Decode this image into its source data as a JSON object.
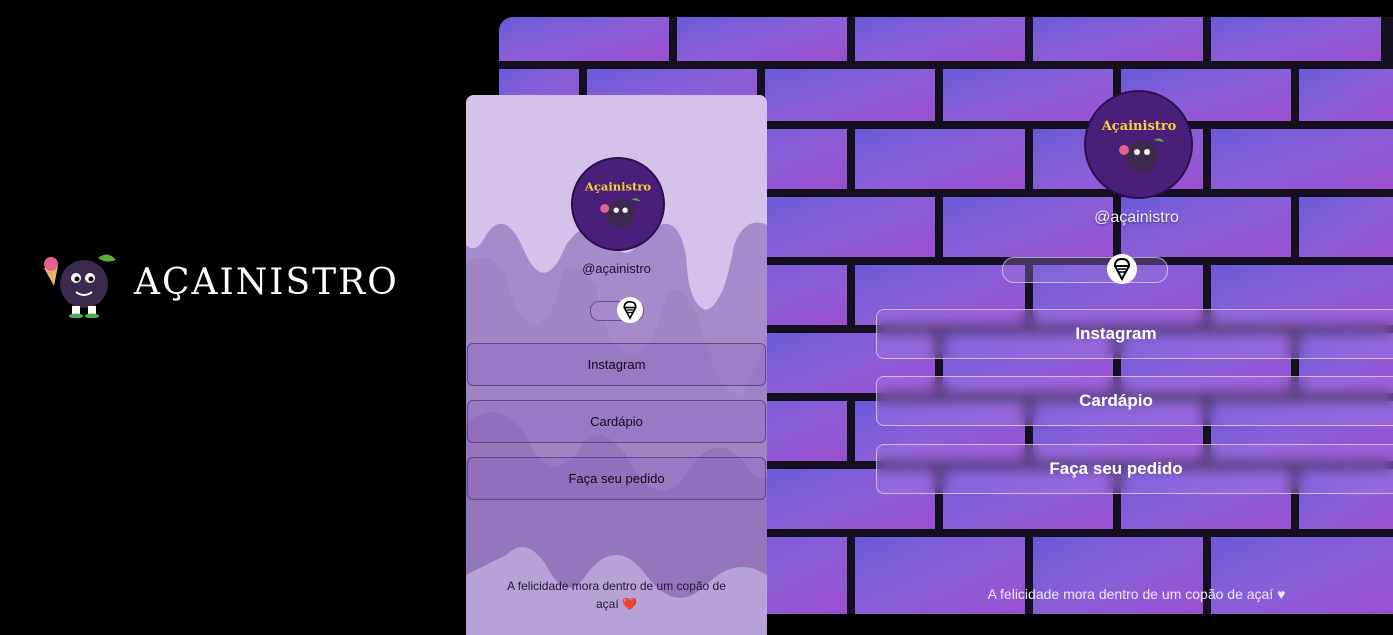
{
  "brand": {
    "name": "AÇAINISTRO",
    "mascot_icon": "acai-mascot-icon"
  },
  "profile": {
    "handle": "@açainistro",
    "avatar_text": "Açainistro",
    "toggle_icon": "ice-cream-icon"
  },
  "links": [
    {
      "label": "Instagram"
    },
    {
      "label": "Cardápio"
    },
    {
      "label": "Faça seu pedido"
    }
  ],
  "footer": {
    "mobile_text": "A felicidade mora dentro de um copão de açaí",
    "mobile_heart": "❤️",
    "desktop_text": "A felicidade mora dentro de um copão de açaí ♥"
  },
  "colors": {
    "background": "#000000",
    "brick": "#7c5ad6",
    "mortar": "#14101f",
    "mobile_bg": "#c7b2e3",
    "avatar": "#4a1f7a"
  }
}
